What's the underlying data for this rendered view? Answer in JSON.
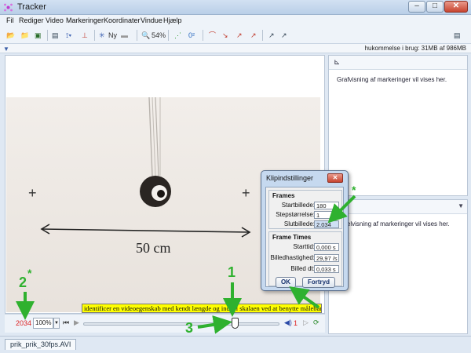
{
  "window": {
    "title": "Tracker"
  },
  "menu": [
    "Fil",
    "Rediger",
    "Video",
    "Markeringer",
    "Koordinater",
    "Vindue",
    "Hjælp"
  ],
  "toolbar": {
    "new_label": "Ny",
    "zoom_label": "54%"
  },
  "status": {
    "memory": "hukommelse i brug: 31MB af 986MB"
  },
  "video_scene": {
    "scale_label": "50 cm"
  },
  "plot_panel": {
    "text": "Grafvisning af markeringer vil vises her."
  },
  "table_panel": {
    "text": "Tabelvisning af markeringer vil vises her."
  },
  "player": {
    "frame_number": "2034",
    "zoom": "100%",
    "step_counter": "1"
  },
  "tooltip": {
    "text": "identificer en videoegenskab med kendt længde og indstil skalaen ved at benytte målebånd"
  },
  "file_tab": {
    "label": "prik_prik_30fps.AVI"
  },
  "dialog": {
    "title": "Klipindstillinger",
    "frames_title": "Frames",
    "start_label": "Startbillede:",
    "start_value": "180",
    "step_label": "Stepstørrelse:",
    "step_value": "1",
    "end_label": "Slutbillede:",
    "end_value": "2.034",
    "times_title": "Frame Times",
    "starttime_label": "Starttid:",
    "starttime_value": "0,000 s",
    "rate_label": "Billedhastighed:",
    "rate_value": "29,97 /s",
    "dt_label": "Billed dt:",
    "dt_value": "0,033 s",
    "ok_label": "OK",
    "cancel_label": "Fortryd"
  },
  "annotations": {
    "n1": "1",
    "n2": "2",
    "n3": "3",
    "star": "*"
  },
  "colors": {
    "annotation": "#2fb12f",
    "highlight": "#ffff00",
    "frame_number": "#dd2222"
  }
}
